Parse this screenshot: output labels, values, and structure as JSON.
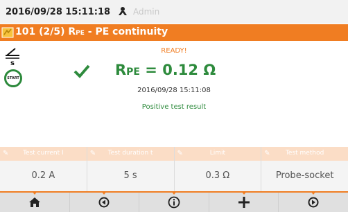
{
  "status": {
    "datetime": "2016/09/28 15:11:18",
    "user": "Admin"
  },
  "title": {
    "prefix": "101 (2/5) R",
    "subscript": "PE",
    "suffix": " - PE continuity"
  },
  "start_label": "START",
  "result": {
    "state": "READY!",
    "symbol": "R",
    "symbol_sub": "PE",
    "value": " = 0.12 Ω",
    "timestamp": "2016/09/28 15:11:08",
    "message": "Positive test result"
  },
  "params": [
    {
      "label": "Test current I",
      "value": "0.2 A"
    },
    {
      "label": "Test duration t",
      "value": "5 s"
    },
    {
      "label": "Limit",
      "value": "0.3 Ω"
    },
    {
      "label": "Test method",
      "value": "Probe-socket"
    }
  ],
  "colors": {
    "accent": "#f07d22",
    "pass": "#2e8b3d",
    "param_head": "#fbddc6"
  },
  "nav_icons": [
    "home-icon",
    "back-icon",
    "info-icon",
    "add-icon",
    "next-icon"
  ]
}
